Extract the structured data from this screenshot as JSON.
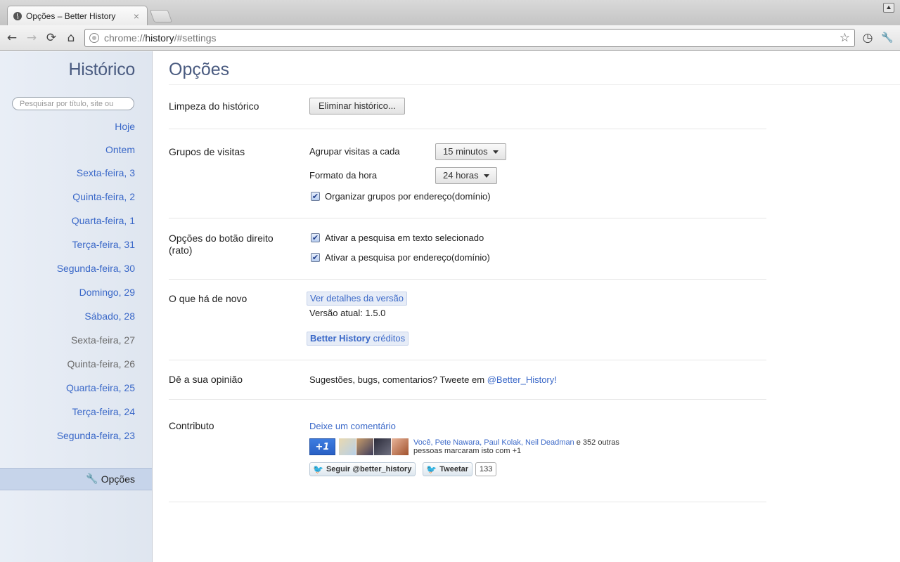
{
  "browser": {
    "tab_title": "Opções – Better History",
    "tab_close": "×",
    "url_scheme": "chrome://",
    "url_host": "history",
    "url_path": "/#settings",
    "icons": {
      "back": "←",
      "forward": "→",
      "reload": "⟳",
      "home": "⌂",
      "star": "☆",
      "history": "◷",
      "wrench": "🔧"
    }
  },
  "sidebar": {
    "title": "Histórico",
    "search_placeholder": "Pesquisar por título, site ou",
    "days": [
      "Hoje",
      "Ontem",
      "Sexta-feira, 3",
      "Quinta-feira, 2",
      "Quarta-feira, 1",
      "Terça-feira, 31",
      "Segunda-feira, 30",
      "Domingo, 29",
      "Sábado, 28",
      "Sexta-feira, 27",
      "Quinta-feira, 26",
      "Quarta-feira, 25",
      "Terça-feira, 24",
      "Segunda-feira, 23"
    ],
    "options_label": "Opções"
  },
  "main": {
    "title": "Opções",
    "clear": {
      "label": "Limpeza do histórico",
      "button": "Eliminar histórico..."
    },
    "groups": {
      "label": "Grupos de visitas",
      "group_every_label": "Agrupar visitas a cada",
      "group_every_value": "15 minutos",
      "time_format_label": "Formato da hora",
      "time_format_value": "24 horas",
      "domain_grouping_label": "Organizar grupos por endereço(domínio)",
      "domain_grouping_checked": true
    },
    "context_menu": {
      "label": "Opções do botão direito (rato)",
      "search_selected_label": "Ativar a pesquisa em texto selecionado",
      "search_selected_checked": true,
      "search_domain_label": "Ativar a pesquisa por endereço(domínio)",
      "search_domain_checked": true
    },
    "whats_new": {
      "label": "O que há de novo",
      "details_link": "Ver detalhes da versão",
      "version_text": "Versão atual: 1.5.0",
      "credits_bold": "Better History",
      "credits_rest": " créditos"
    },
    "feedback": {
      "label": "Dê a sua opinião",
      "text": "Sugestões, bugs, comentarios? Tweete em",
      "handle": "@Better_History!"
    },
    "contribute": {
      "label": "Contributo",
      "comment_link": "Deixe um comentário",
      "plusone": "+1",
      "plus_people": "Você, Pete Nawara, Paul Kolak, Neil Deadman",
      "plus_rest": " e 352 outras",
      "plus_line2": "pessoas marcaram isto com +1",
      "follow_button": "Seguir @better_history",
      "tweet_button": "Tweetar",
      "tweet_count": "133"
    }
  },
  "colors": {
    "link": "#3a68c8",
    "heading": "#4a5b80",
    "sidebar_selected": "#c6d4ea"
  }
}
